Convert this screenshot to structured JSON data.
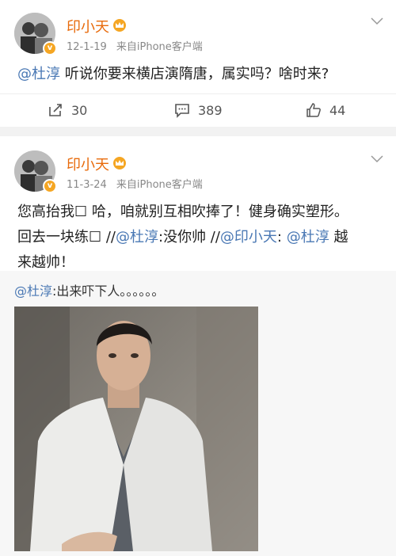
{
  "post1": {
    "username": "印小天",
    "date": "12-1-19",
    "source": "来自iPhone客户端",
    "mention": "@杜淳",
    "text": " 听说你要来横店演隋唐，属实吗？啥时来?",
    "actions": {
      "repost": "30",
      "comment": "389",
      "like": "44"
    }
  },
  "post2": {
    "username": "印小天",
    "date": "11-3-24",
    "source": "来自iPhone客户端",
    "line1": "您高抬我☐ 哈，咱就别互相吹捧了！健身确实塑形。",
    "line2_a": "回去一块练☐ //",
    "mention1": "@杜淳",
    "line2_b": ":没你帅 //",
    "mention2": "@印小天",
    "line2_c": ": ",
    "mention3": "@杜淳",
    "line2_d": " 越",
    "line3": "来越帅！",
    "repost": {
      "mention": "@杜淳",
      "text": ":出来吓下人。。。。。。"
    }
  },
  "icons": [
    "repost-icon",
    "comment-icon",
    "like-icon",
    "chevron-down-icon",
    "crown-icon",
    "verified-badge-icon"
  ],
  "colors": {
    "username": "#e86b0c",
    "mention": "#4a78b4",
    "meta": "#888888",
    "badge": "#f5a623"
  }
}
